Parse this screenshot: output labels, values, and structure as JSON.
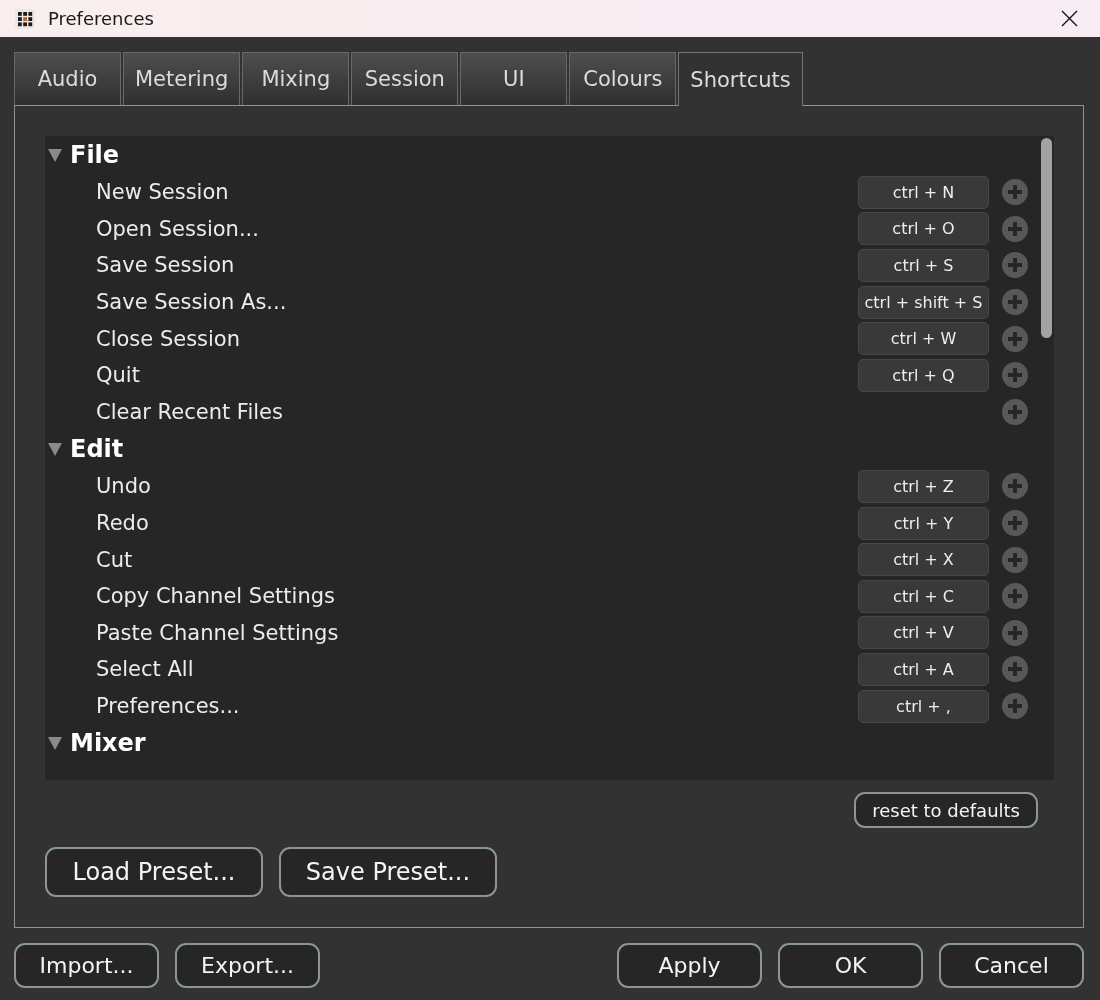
{
  "window": {
    "title": "Preferences"
  },
  "tabs": [
    {
      "label": "Audio",
      "selected": false
    },
    {
      "label": "Metering",
      "selected": false
    },
    {
      "label": "Mixing",
      "selected": false
    },
    {
      "label": "Session",
      "selected": false
    },
    {
      "label": "UI",
      "selected": false
    },
    {
      "label": "Colours",
      "selected": false
    },
    {
      "label": "Shortcuts",
      "selected": true
    }
  ],
  "shortcuts": {
    "groups": [
      {
        "name": "File",
        "expanded": true,
        "actions": [
          {
            "label": "New Session",
            "keys": "ctrl + N"
          },
          {
            "label": "Open Session...",
            "keys": "ctrl + O"
          },
          {
            "label": "Save Session",
            "keys": "ctrl + S"
          },
          {
            "label": "Save Session As...",
            "keys": "ctrl + shift + S"
          },
          {
            "label": "Close Session",
            "keys": "ctrl + W"
          },
          {
            "label": "Quit",
            "keys": "ctrl + Q"
          },
          {
            "label": "Clear Recent Files"
          }
        ]
      },
      {
        "name": "Edit",
        "expanded": true,
        "actions": [
          {
            "label": "Undo",
            "keys": "ctrl + Z"
          },
          {
            "label": "Redo",
            "keys": "ctrl + Y"
          },
          {
            "label": "Cut",
            "keys": "ctrl + X"
          },
          {
            "label": "Copy Channel Settings",
            "keys": "ctrl + C"
          },
          {
            "label": "Paste Channel Settings",
            "keys": "ctrl + V"
          },
          {
            "label": "Select All",
            "keys": "ctrl + A"
          },
          {
            "label": "Preferences...",
            "keys": "ctrl + ,"
          }
        ]
      },
      {
        "name": "Mixer",
        "expanded": true
      }
    ],
    "reset_button": "reset to defaults"
  },
  "preset_buttons": [
    "Load Preset...",
    "Save Preset..."
  ],
  "footer": {
    "left_buttons": [
      "Import...",
      "Export..."
    ],
    "right_buttons": [
      "Apply",
      "OK",
      "Cancel"
    ]
  }
}
